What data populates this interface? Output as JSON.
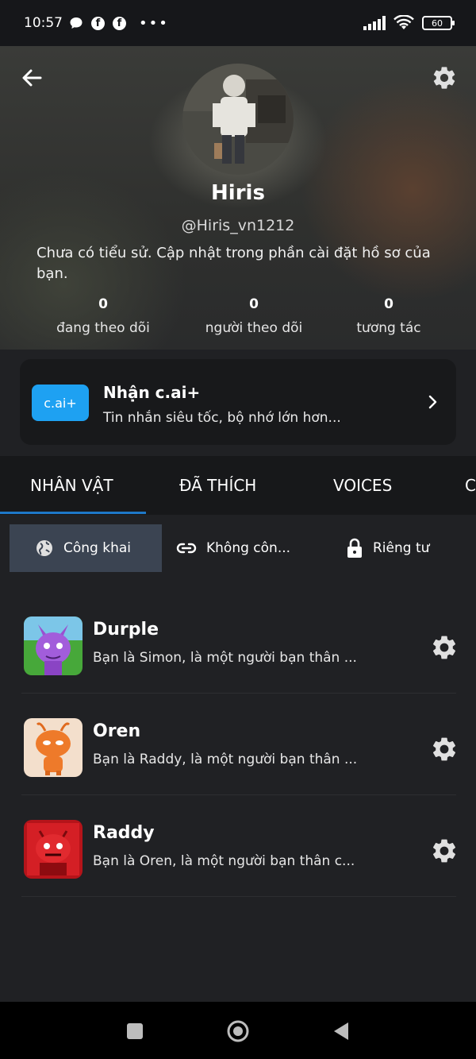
{
  "status_bar": {
    "time": "10:57",
    "fb_glyph": "f",
    "dots": "•••",
    "battery": "60",
    "icons": [
      "chat-bubble-icon",
      "facebook-icon",
      "facebook-icon",
      "signal-icon",
      "wifi-icon",
      "battery-icon"
    ]
  },
  "profile": {
    "name": "Hiris",
    "handle": "@Hiris_vn1212",
    "bio": "Chưa có tiểu sử. Cập nhật trong phần cài đặt hồ sơ của bạn.",
    "stats": [
      {
        "value": "0",
        "label": "đang theo dõi"
      },
      {
        "value": "0",
        "label": "người theo dõi"
      },
      {
        "value": "0",
        "label": "tương tác"
      }
    ]
  },
  "promo": {
    "badge": "c.ai+",
    "title": "Nhận c.ai+",
    "subtitle": "Tin nhắn siêu tốc, bộ nhớ lớn hơn..."
  },
  "tabs": [
    {
      "label": "NHÂN VẬT",
      "active": true
    },
    {
      "label": "ĐÃ THÍCH",
      "active": false
    },
    {
      "label": "VOICES",
      "active": false
    },
    {
      "label": "C",
      "active": false
    }
  ],
  "filters": [
    {
      "label": "Công khai",
      "icon": "globe-icon",
      "active": true
    },
    {
      "label": "Không côn...",
      "icon": "link-icon",
      "active": false
    },
    {
      "label": "Riêng tư",
      "icon": "lock-icon",
      "active": false
    }
  ],
  "characters": [
    {
      "name": "Durple",
      "description": "Bạn là Simon, là một người bạn thân ..."
    },
    {
      "name": "Oren",
      "description": "Bạn là Raddy, là một người bạn thân ..."
    },
    {
      "name": "Raddy",
      "description": "Bạn là Oren, là một người bạn thân c..."
    }
  ],
  "colors": {
    "background": "#202124",
    "accent": "#1e78c8",
    "promo_badge": "#1ea1f2",
    "filter_active": "#3b4452"
  }
}
